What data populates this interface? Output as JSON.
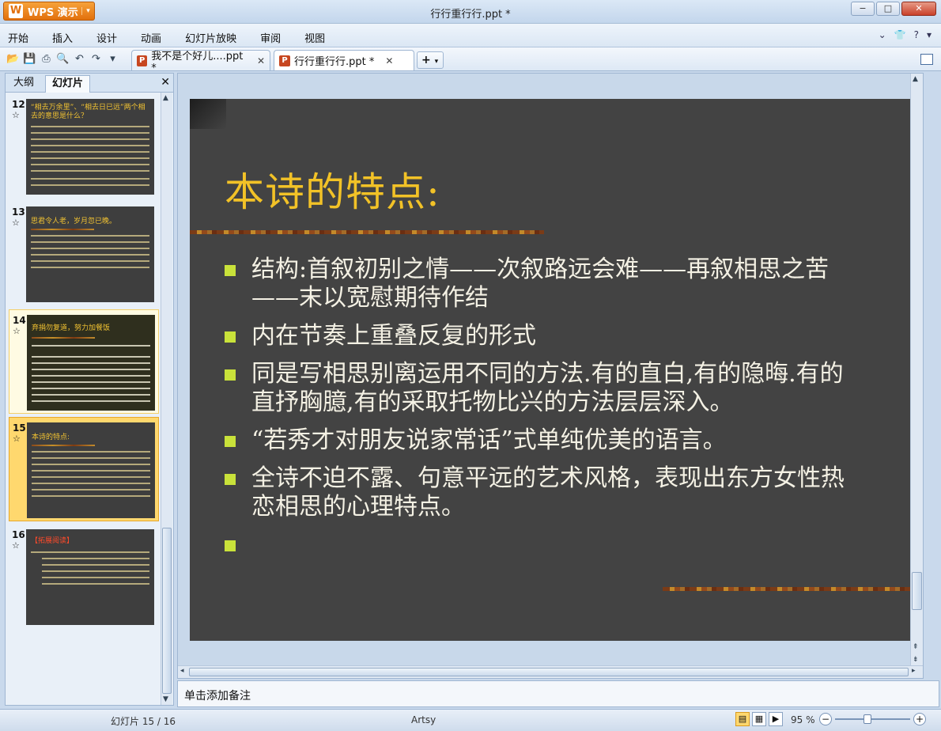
{
  "app": {
    "name": "WPS 演示",
    "document_title": "行行重行行.ppt *"
  },
  "window_controls": {
    "minimize": "−",
    "maximize": "□",
    "close": "✕"
  },
  "menu": {
    "items": [
      "开始",
      "插入",
      "设计",
      "动画",
      "幻灯片放映",
      "审阅",
      "视图"
    ]
  },
  "toolbar_icons": [
    "open-icon",
    "save-icon",
    "print-icon",
    "print-preview-icon",
    "undo-icon",
    "redo-icon",
    "dropdown-icon"
  ],
  "doc_tabs": [
    {
      "label": "我不是个好儿....ppt *",
      "active": false
    },
    {
      "label": "行行重行行.ppt *",
      "active": true
    }
  ],
  "left_pane": {
    "tabs": [
      "大纲",
      "幻灯片"
    ],
    "active_tab": "幻灯片",
    "thumbnails": [
      {
        "number": "12",
        "title": "“相去万余里”、“相去日已远”两个相去的意思是什么？"
      },
      {
        "number": "13",
        "title": "思君令人老，岁月忽已晚。"
      },
      {
        "number": "14",
        "title": "弃捐勿复道，努力加餐饭"
      },
      {
        "number": "15",
        "title": "本诗的特点:"
      },
      {
        "number": "16",
        "title": "【拓展阅读】"
      }
    ],
    "selected": "15"
  },
  "slide": {
    "title": "本诗的特点:",
    "bullets": [
      "结构:首叙初别之情——次叙路远会难——再叙相思之苦——末以宽慰期待作结",
      "内在节奏上重叠反复的形式",
      "同是写相思别离运用不同的方法.有的直白,有的隐晦.有的直抒胸臆,有的采取托物比兴的方法层层深入。",
      "“若秀才对朋友说家常话”式单纯优美的语言。",
      "全诗不迫不露、句意平远的艺术风格，表现出东方女性热恋相思的心理特点。",
      ""
    ],
    "colors": {
      "background": "#434343",
      "title": "#f2c227",
      "text": "#f4f1e4",
      "bullet": "#c9e23a"
    }
  },
  "notes": {
    "placeholder": "单击添加备注"
  },
  "status": {
    "slide_indicator": "幻灯片 15 / 16",
    "theme": "Artsy",
    "zoom": "95 %",
    "zoom_level": 0.43
  }
}
